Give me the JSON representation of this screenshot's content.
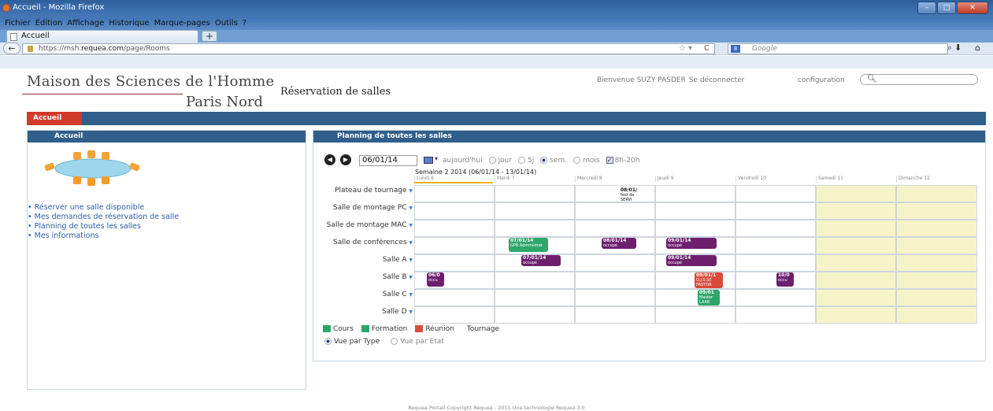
{
  "browser": {
    "window_title": "Accueil - Mozilla Firefox",
    "menu": [
      "Fichier",
      "Édition",
      "Affichage",
      "Historique",
      "Marque-pages",
      "Outils",
      "?"
    ],
    "tab_label": "Accueil",
    "new_tab": "+",
    "url_prefix": "https://msh.",
    "url_domain": "requea.com",
    "url_path": "/page/Rooms",
    "search_engine_placeholder": "Google"
  },
  "header": {
    "logo_line1": "Maison des Sciences de l'Homme",
    "logo_line2": "Paris Nord",
    "app_title": "Réservation de salles",
    "welcome": "Bienvenue SUZY PASDER",
    "logout": "Se déconnecter",
    "configuration": "configuration"
  },
  "mainnav": {
    "tab": "Accueil"
  },
  "left": {
    "header": "Accueil",
    "links": [
      "Réserver une salle disponible",
      "Mes demandes de réservation de salle",
      "Planning de toutes les salles",
      "Mes informations"
    ]
  },
  "planning": {
    "header": "Planning de toutes les salles",
    "date": "06/01/14",
    "today": "aujourd'hui",
    "view_options": [
      "jour",
      "5j",
      "sem.",
      "mois"
    ],
    "selected_view": "sem.",
    "hours_label": "8h-20h",
    "hours_checked": true,
    "week_label": "Semaine 2 2014 (06/01/14 - 13/01/14)",
    "days": [
      "Lundi 6",
      "Mardi 7",
      "Mercredi 8",
      "Jeudi 9",
      "Vendredi 10",
      "Samedi 11",
      "Dimanche 12"
    ],
    "rooms": [
      "Plateau de tournage",
      "Salle de montage PC",
      "Salle de montage MAC",
      "Salle de conférences",
      "Salle A",
      "Salle B",
      "Salle C",
      "Salle D"
    ],
    "events": [
      {
        "room": 0,
        "day": 2,
        "color": "white",
        "title": "08/01/",
        "sub": "test de SERVI"
      },
      {
        "room": 3,
        "day": 1,
        "color": "green",
        "title": "07/01/14",
        "sub": "GPB Administrat"
      },
      {
        "room": 3,
        "day": 2,
        "color": "purple",
        "title": "08/01/14",
        "sub": "occupé"
      },
      {
        "room": 3,
        "day": 3,
        "color": "purple",
        "title": "09/01/14",
        "sub": "occupé"
      },
      {
        "room": 4,
        "day": 1,
        "color": "purple",
        "title": "07/01/14",
        "sub": "occupé"
      },
      {
        "room": 4,
        "day": 3,
        "color": "purple",
        "title": "09/01/14",
        "sub": "occupé"
      },
      {
        "room": 5,
        "day": 0,
        "color": "purple",
        "title": "06/0",
        "sub": "occu"
      },
      {
        "room": 5,
        "day": 3,
        "color": "red",
        "title": "09/01/1",
        "sub": "O.J.S.SE PASTOR"
      },
      {
        "room": 5,
        "day": 4,
        "color": "purple",
        "title": "10/0",
        "sub": "occu"
      },
      {
        "room": 6,
        "day": 3,
        "color": "green",
        "title": "09/01",
        "sub": "Master LAAR"
      }
    ],
    "legend": [
      {
        "label": "Cours",
        "color": "#2ea66a"
      },
      {
        "label": "Formation",
        "color": "#2ea66a"
      },
      {
        "label": "Réunion",
        "color": "#d94a3a"
      },
      {
        "label": "Tournage",
        "color": ""
      }
    ],
    "view_by_type": "Vue par Type",
    "view_by_state": "Vue par Etat"
  },
  "footer": "Requea Portail  Copyright Requea - 2011  Une technologie Requea 3.0"
}
